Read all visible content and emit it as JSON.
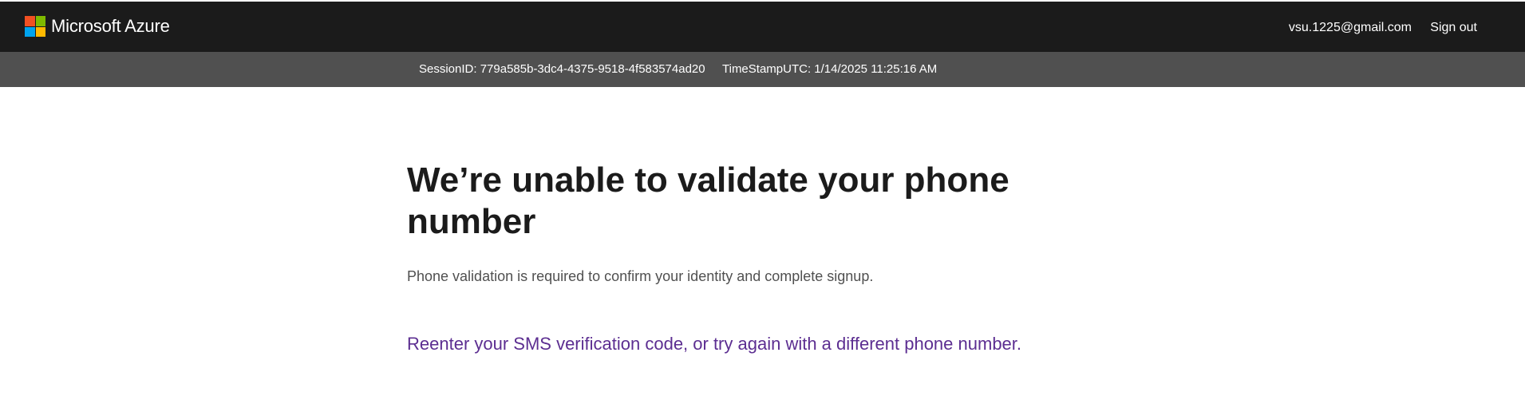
{
  "header": {
    "brand": "Microsoft Azure",
    "logo_colors": [
      "#f25022",
      "#7fba00",
      "#00a4ef",
      "#ffb900"
    ],
    "user_email": "vsu.1225@gmail.com",
    "sign_out_label": "Sign out"
  },
  "session": {
    "session_id_text": "SessionID: 779a585b-3dc4-4375-9518-4f583574ad20",
    "timestamp_text": "TimeStampUTC: 1/14/2025 11:25:16 AM"
  },
  "main": {
    "title": "We’re unable to validate your phone number",
    "subtitle": "Phone validation is required to confirm your identity and complete signup.",
    "retry_link": "Reenter your SMS verification code, or try again with a different phone number."
  },
  "colors": {
    "topbar": "#1b1b1b",
    "sessionbar": "#505050",
    "link": "#5c2e91"
  }
}
